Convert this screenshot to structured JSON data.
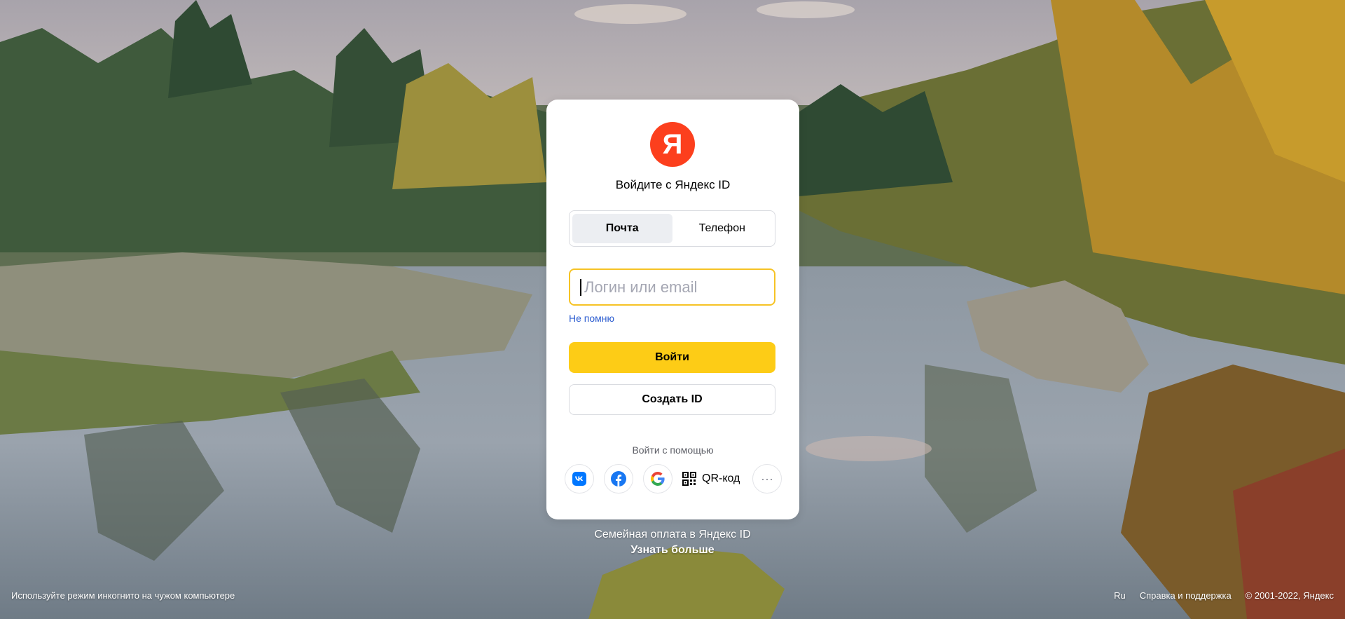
{
  "background": {
    "scene": "autumn-forest-river"
  },
  "card": {
    "logo_letter": "Я",
    "title": "Войдите с Яндекс ID",
    "tabs": [
      {
        "label": "Почта",
        "active": true
      },
      {
        "label": "Телефон",
        "active": false
      }
    ],
    "login_input": {
      "value": "",
      "placeholder": "Логин или email"
    },
    "forgot_link": "Не помню",
    "login_button": "Войти",
    "create_button": "Создать ID",
    "social_label": "Войти с помощью",
    "social_buttons": [
      {
        "icon": "vk-icon"
      },
      {
        "icon": "facebook-icon"
      },
      {
        "icon": "google-icon"
      }
    ],
    "qr_label": "QR-код",
    "more_icon": "more-dots-icon"
  },
  "promo": {
    "text": "Семейная оплата в Яндекс ID",
    "link": "Узнать больше"
  },
  "footer": {
    "incognito_hint": "Используйте режим инкогнито на чужом компьютере",
    "language": "Ru",
    "help": "Справка и поддержка",
    "copyright": "© 2001-2022, Яндекс"
  },
  "colors": {
    "brand_red": "#fc3f1d",
    "accent_yellow": "#fdcc16",
    "focus_border": "#f6c325",
    "link_blue": "#2f5fd1"
  }
}
